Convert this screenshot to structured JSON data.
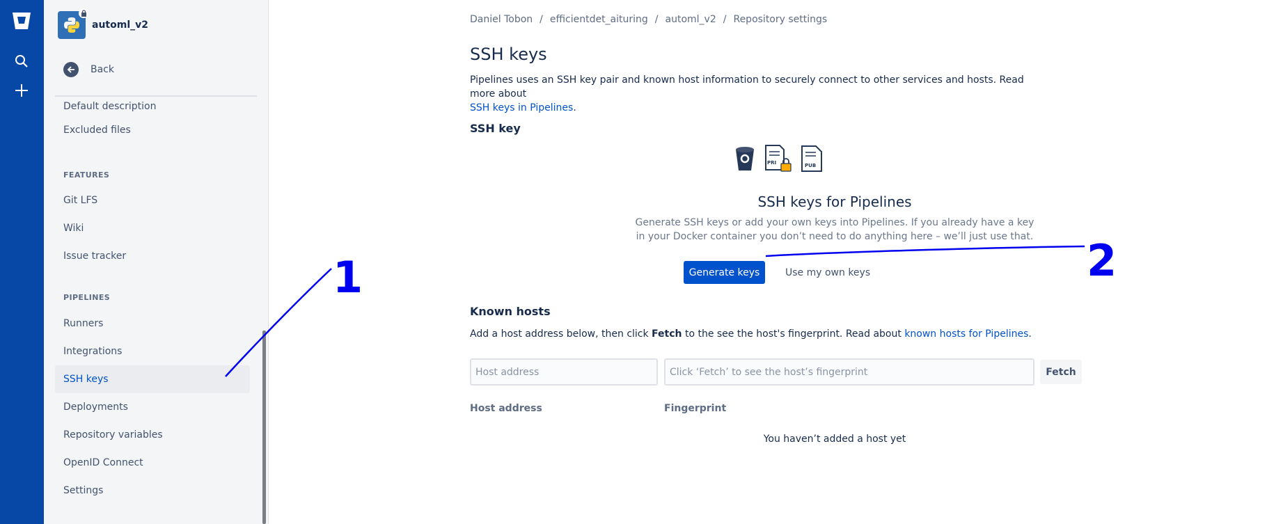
{
  "global_nav": {
    "icons": [
      "bitbucket-logo-icon",
      "search-icon",
      "plus-icon"
    ]
  },
  "sidebar": {
    "repo_name": "automl_v2",
    "back_label": "Back",
    "items_top": [
      {
        "label": "Default description"
      },
      {
        "label": "Excluded files"
      }
    ],
    "features_heading": "FEATURES",
    "features": [
      {
        "label": "Git LFS"
      },
      {
        "label": "Wiki"
      },
      {
        "label": "Issue tracker"
      }
    ],
    "pipelines_heading": "PIPELINES",
    "pipelines": [
      {
        "label": "Runners",
        "active": false
      },
      {
        "label": "Integrations",
        "active": false
      },
      {
        "label": "SSH keys",
        "active": true
      },
      {
        "label": "Deployments",
        "active": false
      },
      {
        "label": "Repository variables",
        "active": false
      },
      {
        "label": "OpenID Connect",
        "active": false
      },
      {
        "label": "Settings",
        "active": false
      }
    ]
  },
  "breadcrumb": [
    "Daniel Tobon",
    "efficientdet_aituring",
    "automl_v2",
    "Repository settings"
  ],
  "page": {
    "title": "SSH keys",
    "intro_text": "Pipelines uses an SSH key pair and known host information to securely connect to other services and hosts. Read more about",
    "intro_link": "SSH keys in Pipelines",
    "intro_end": "."
  },
  "ssh_key": {
    "heading": "SSH key",
    "icon_labels": {
      "private": "PRI",
      "public": "PUB"
    },
    "empty_title": "SSH keys for Pipelines",
    "empty_desc_line1": "Generate SSH keys or add your own keys into Pipelines. If you already have a key",
    "empty_desc_line2": "in your Docker container you don’t need to do anything here – we’ll just use that.",
    "generate_button": "Generate keys",
    "own_keys_button": "Use my own keys"
  },
  "known_hosts": {
    "heading": "Known hosts",
    "desc_before": "Add a host address below, then click ",
    "desc_bold": "Fetch",
    "desc_middle": " to the see the host's fingerprint. Read about ",
    "desc_link": "known hosts for Pipelines",
    "desc_end": ".",
    "host_placeholder": "Host address",
    "fingerprint_placeholder": "Click ‘Fetch’ to see the host’s fingerprint",
    "fetch_button": "Fetch",
    "col_host": "Host address",
    "col_fingerprint": "Fingerprint",
    "empty_text": "You haven’t added a host yet"
  },
  "annotations": {
    "label_1": "1",
    "label_2": "2",
    "color": "#0000f0"
  },
  "colors": {
    "global_nav": "#0747a6",
    "primary": "#0052cc",
    "sidebar_bg": "#f4f5f7"
  }
}
